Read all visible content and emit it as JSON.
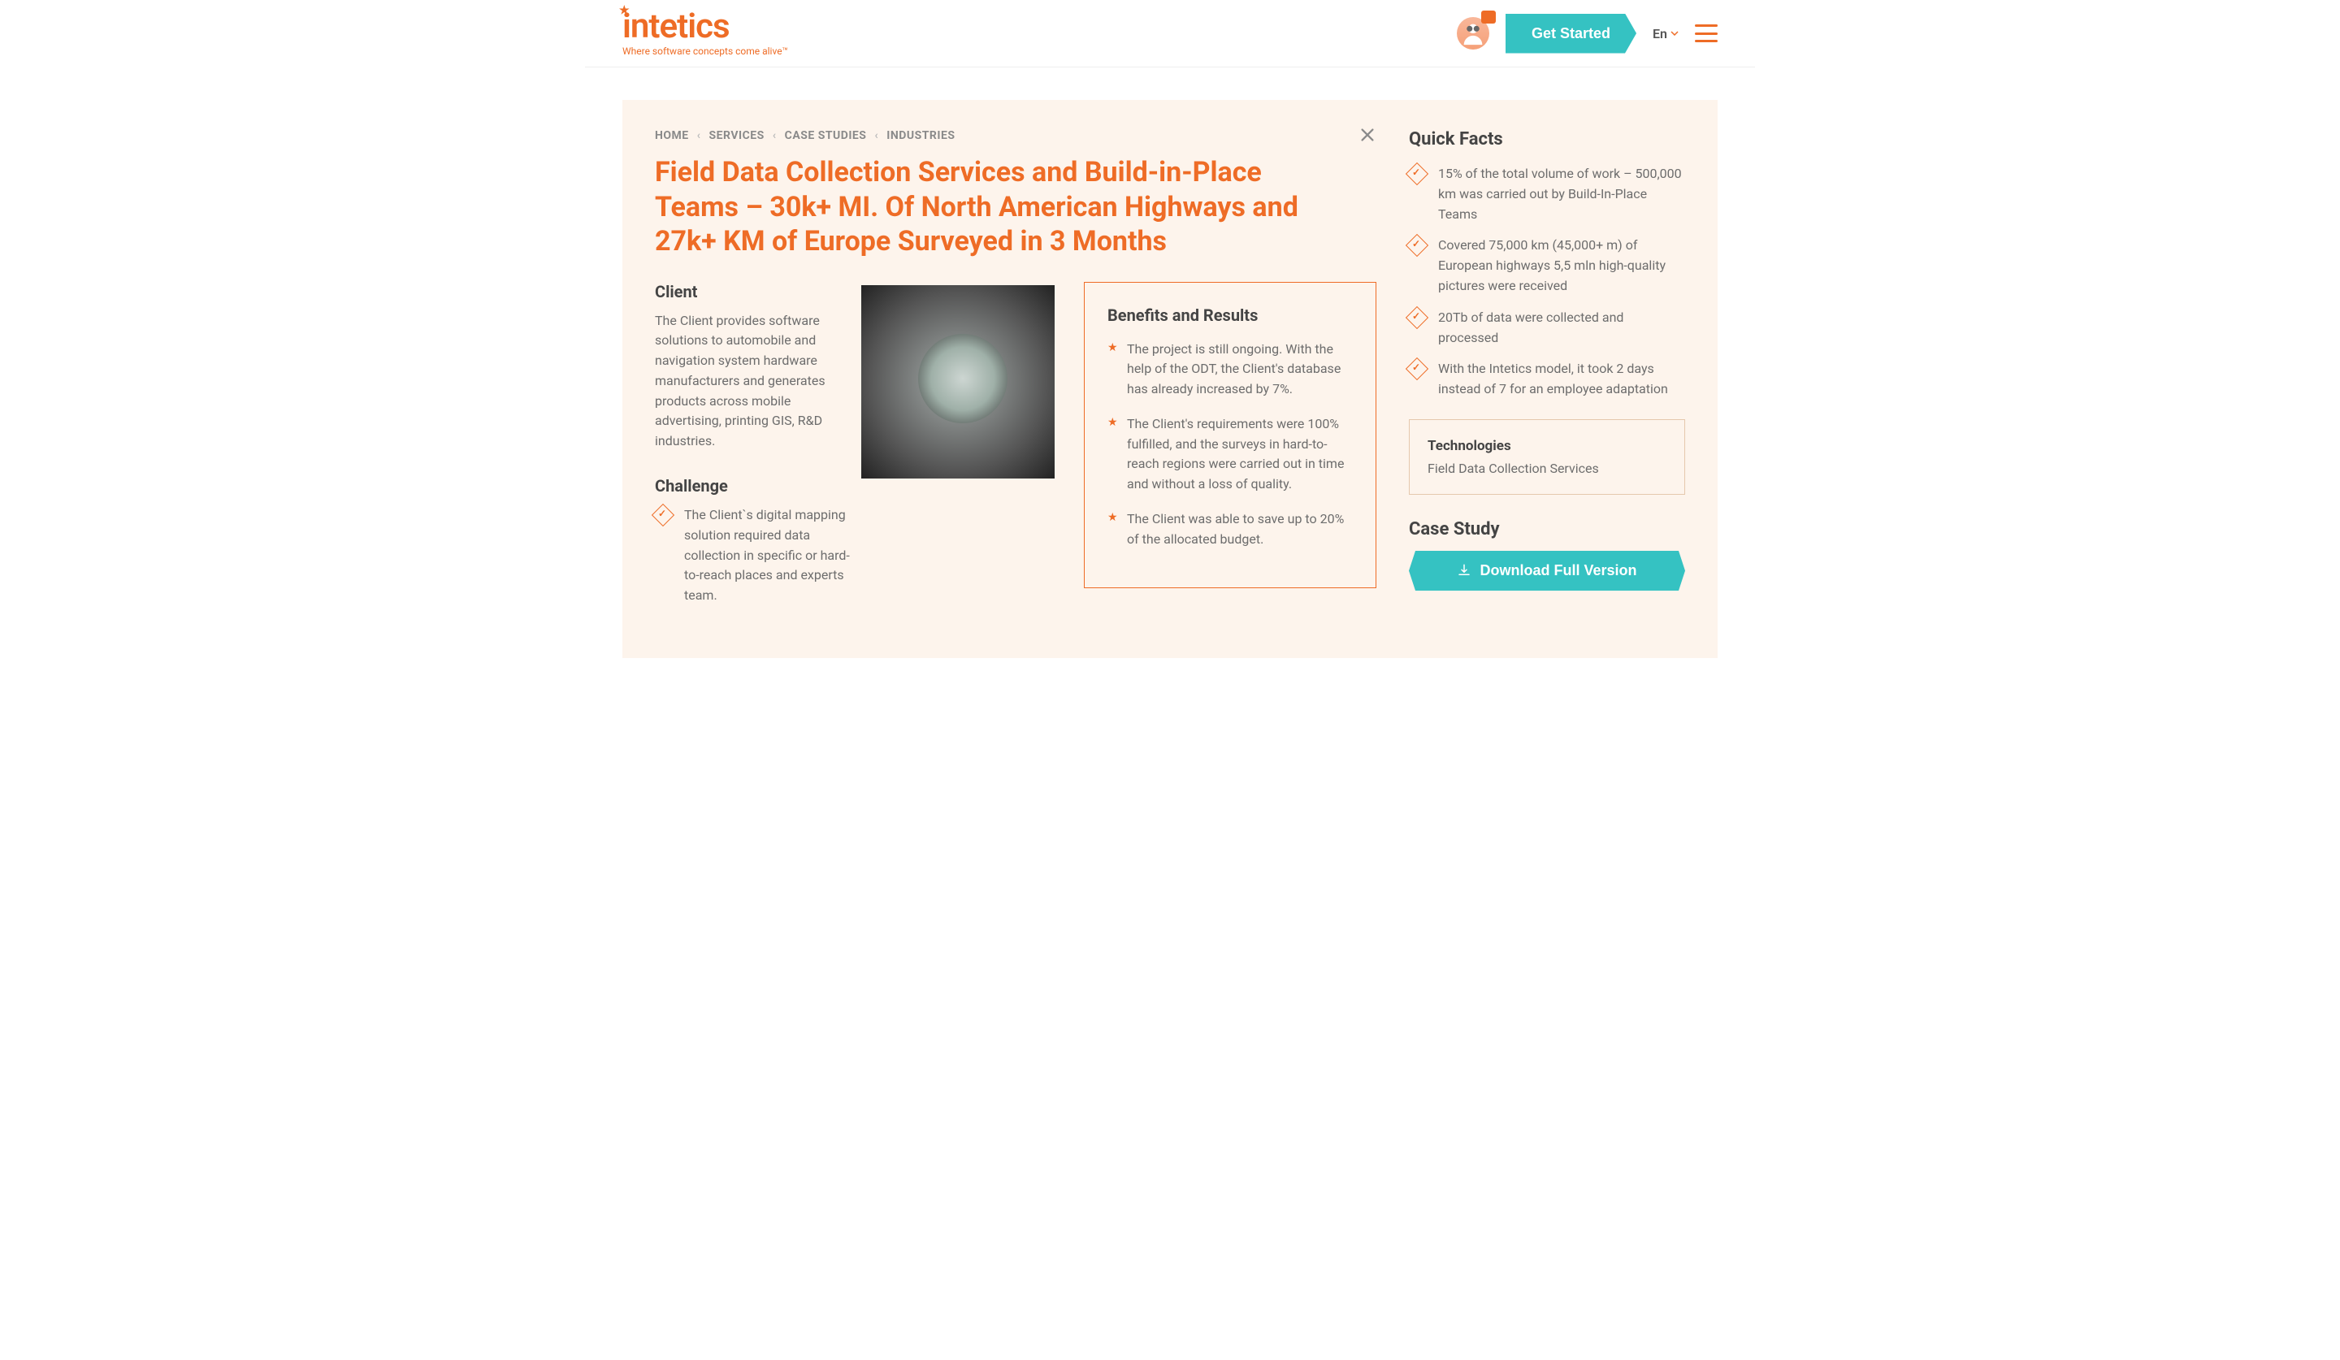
{
  "header": {
    "logo": "intetics",
    "tagline": "Where software concepts come alive™",
    "cta": "Get Started",
    "lang": "En"
  },
  "breadcrumbs": [
    "HOME",
    "SERVICES",
    "CASE STUDIES",
    "INDUSTRIES"
  ],
  "title": "Field Data Collection Services and Build-in-Place Teams – 30k+ MI. Of North American Highways and 27k+ KM of Europe Surveyed in 3 Months",
  "client": {
    "heading": "Client",
    "text": "The Client provides software solutions to automobile and navigation system hardware manufacturers and generates products across mobile advertising, printing GIS, R&D industries."
  },
  "challenge": {
    "heading": "Challenge",
    "items": [
      "The Client`s digital mapping solution required data collection in specific or hard-to-reach places and experts team."
    ]
  },
  "results": {
    "heading": "Benefits and Results",
    "items": [
      "The project is still ongoing. With the help of the ODT, the Client's database has already increased by 7%.",
      "The Client's requirements were 100% fulfilled, and the surveys in hard-to-reach regions were carried out in time and without a loss of quality.",
      "The Client was able to save up to 20% of the allocated budget."
    ]
  },
  "facts": {
    "heading": "Quick Facts",
    "items": [
      "15% of the total volume of work – 500,000 km was carried out by Build-In-Place Teams",
      "Covered 75,000 km (45,000+ m) of European highways 5,5 mln high-quality pictures were received",
      "20Tb of data were collected and processed",
      "With the Intetics model, it took 2 days instead of 7 for an employee adaptation"
    ]
  },
  "tech": {
    "label": "Technologies",
    "value": "Field Data Collection Services"
  },
  "casestudy": {
    "heading": "Case Study",
    "button": "Download Full Version"
  }
}
